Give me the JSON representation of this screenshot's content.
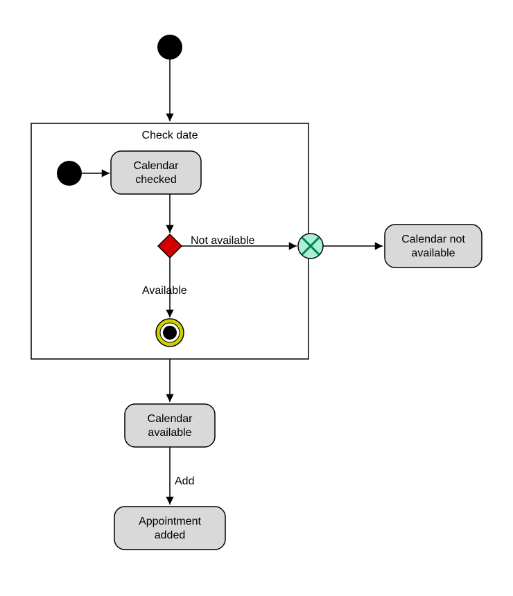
{
  "diagram": {
    "frame_title": "Check date",
    "nodes": {
      "calendar_checked": "Calendar checked",
      "calendar_not_available": "Calendar not available",
      "calendar_available": "Calendar available",
      "appointment_added": "Appointment added"
    },
    "edges": {
      "not_available": "Not available",
      "available": "Available",
      "add": "Add"
    }
  },
  "chart_data": {
    "type": "diagram",
    "notation": "UML activity diagram",
    "nodes": [
      {
        "id": "start_outer",
        "kind": "initial"
      },
      {
        "id": "frame",
        "kind": "structured-activity",
        "label": "Check date",
        "children": [
          {
            "id": "start_inner",
            "kind": "initial"
          },
          {
            "id": "calendar_checked",
            "kind": "action",
            "label": "Calendar checked"
          },
          {
            "id": "decision",
            "kind": "decision"
          },
          {
            "id": "final_inner",
            "kind": "activity-final"
          }
        ]
      },
      {
        "id": "exception",
        "kind": "exception-handler"
      },
      {
        "id": "calendar_not_available",
        "kind": "action",
        "label": "Calendar not available"
      },
      {
        "id": "calendar_available",
        "kind": "action",
        "label": "Calendar available"
      },
      {
        "id": "appointment_added",
        "kind": "action",
        "label": "Appointment added"
      }
    ],
    "edges": [
      {
        "from": "start_outer",
        "to": "frame"
      },
      {
        "from": "start_inner",
        "to": "calendar_checked"
      },
      {
        "from": "calendar_checked",
        "to": "decision"
      },
      {
        "from": "decision",
        "to": "exception",
        "guard": "Not available"
      },
      {
        "from": "decision",
        "to": "final_inner",
        "guard": "Available"
      },
      {
        "from": "exception",
        "to": "calendar_not_available"
      },
      {
        "from": "frame",
        "to": "calendar_available"
      },
      {
        "from": "calendar_available",
        "to": "appointment_added",
        "guard": "Add"
      }
    ]
  }
}
